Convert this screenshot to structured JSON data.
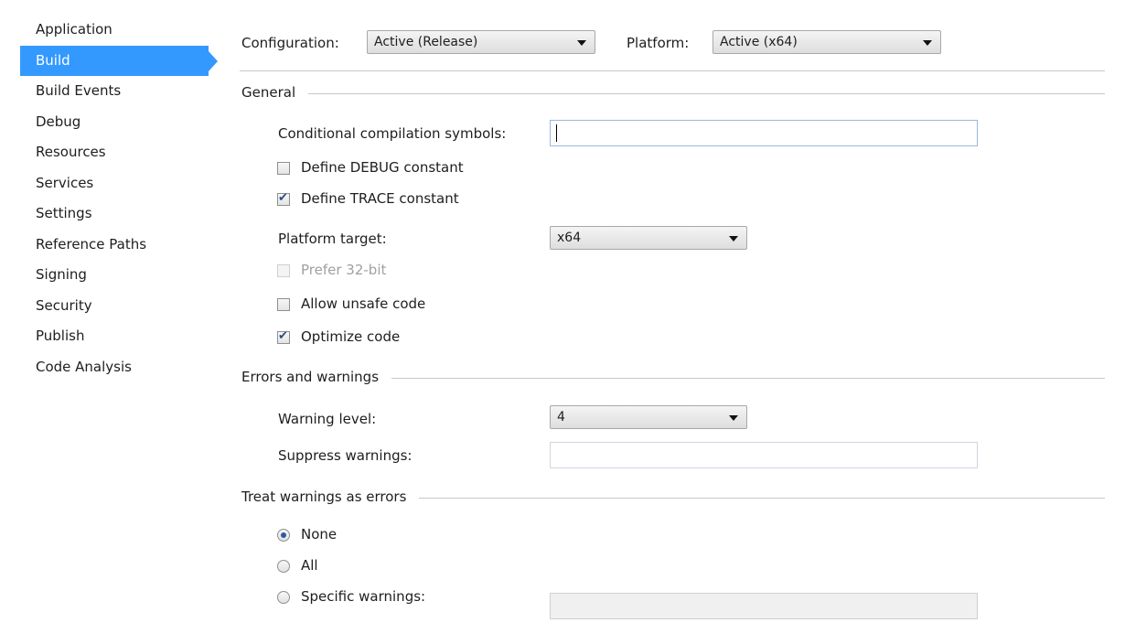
{
  "sidebar": {
    "items": [
      {
        "label": "Application",
        "selected": false
      },
      {
        "label": "Build",
        "selected": true
      },
      {
        "label": "Build Events",
        "selected": false
      },
      {
        "label": "Debug",
        "selected": false
      },
      {
        "label": "Resources",
        "selected": false
      },
      {
        "label": "Services",
        "selected": false
      },
      {
        "label": "Settings",
        "selected": false
      },
      {
        "label": "Reference Paths",
        "selected": false
      },
      {
        "label": "Signing",
        "selected": false
      },
      {
        "label": "Security",
        "selected": false
      },
      {
        "label": "Publish",
        "selected": false
      },
      {
        "label": "Code Analysis",
        "selected": false
      }
    ],
    "accent_color": "#3399ff"
  },
  "toolbar": {
    "configuration_label": "Configuration:",
    "configuration_value": "Active (Release)",
    "platform_label": "Platform:",
    "platform_value": "Active (x64)"
  },
  "general": {
    "title": "General",
    "conditional_symbols_label": "Conditional compilation symbols:",
    "conditional_symbols_value": "",
    "define_debug_label": "Define DEBUG constant",
    "define_debug_checked": false,
    "define_trace_label": "Define TRACE constant",
    "define_trace_checked": true,
    "platform_target_label": "Platform target:",
    "platform_target_value": "x64",
    "prefer_32bit_label": "Prefer 32-bit",
    "prefer_32bit_checked": false,
    "prefer_32bit_enabled": false,
    "allow_unsafe_label": "Allow unsafe code",
    "allow_unsafe_checked": false,
    "optimize_label": "Optimize code",
    "optimize_checked": true
  },
  "errors": {
    "title": "Errors and warnings",
    "warning_level_label": "Warning level:",
    "warning_level_value": "4",
    "suppress_label": "Suppress warnings:",
    "suppress_value": ""
  },
  "treat_warnings": {
    "title": "Treat warnings as errors",
    "options": [
      {
        "label": "None",
        "selected": true
      },
      {
        "label": "All",
        "selected": false
      },
      {
        "label": "Specific warnings:",
        "selected": false
      }
    ],
    "specific_value": ""
  }
}
